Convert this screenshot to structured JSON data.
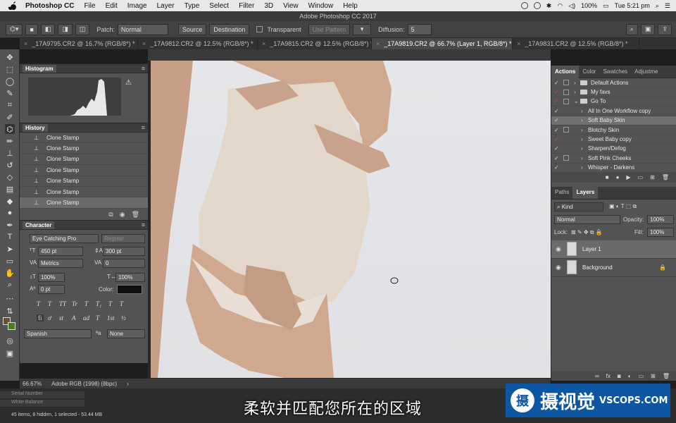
{
  "menubar": {
    "items": [
      "Photoshop CC",
      "File",
      "Edit",
      "Image",
      "Layer",
      "Type",
      "Select",
      "Filter",
      "3D",
      "View",
      "Window",
      "Help"
    ],
    "battery": "100%",
    "clock": "Tue 5:21 pm"
  },
  "window": {
    "title": "Adobe Photoshop CC 2017"
  },
  "options": {
    "patch_label": "Patch:",
    "patch_mode": "Normal",
    "source": "Source",
    "destination": "Destination",
    "transparent": "Transparent",
    "use_pattern": "Use Pattern",
    "diffusion_label": "Diffusion:",
    "diffusion_value": "5"
  },
  "tabs": [
    "_17A9795.CR2 @ 16.7% (RGB/8*) *",
    "_17A9812.CR2 @ 12.5% (RGB/8*) *",
    "_17A9815.CR2 @ 12.5% (RGB/8*) *",
    "_17A9819.CR2 @ 66.7% (Layer 1, RGB/8*) *",
    "_17A9831.CR2 @ 12.5% (RGB/8*) *"
  ],
  "histogram": {
    "title": "Histogram"
  },
  "history": {
    "title": "History",
    "items": [
      "Clone Stamp",
      "Clone Stamp",
      "Clone Stamp",
      "Clone Stamp",
      "Clone Stamp",
      "Clone Stamp",
      "Clone Stamp"
    ]
  },
  "character": {
    "title": "Character",
    "font_family": "Eye Catching Pro",
    "font_style": "Regular",
    "size": "450 pt",
    "leading": "300 pt",
    "kerning": "Metrics",
    "tracking": "0",
    "vscale": "100%",
    "hscale": "100%",
    "baseline": "0 pt",
    "color_label": "Color:",
    "language": "Spanish",
    "aa_label": "a",
    "antialias": "None",
    "type_buttons": [
      "T",
      "T",
      "TT",
      "Tr",
      "T",
      "T₁",
      "T",
      "T"
    ],
    "ligature_buttons": [
      "fi",
      "ơ",
      "st",
      "A",
      "ad",
      "T",
      "1st",
      "½"
    ]
  },
  "actions": {
    "tabs": [
      "Actions",
      "Color",
      "Swatches",
      "Adjustme"
    ],
    "items": [
      {
        "label": "Default Actions",
        "type": "set",
        "open": false,
        "check_red": false
      },
      {
        "label": "My favs",
        "type": "set",
        "open": false,
        "check_red": true
      },
      {
        "label": "Go To",
        "type": "set",
        "open": true,
        "check_red": true
      },
      {
        "label": "All In One Workflow copy",
        "type": "action",
        "check_red": false
      },
      {
        "label": "Soft Baby Skin",
        "type": "action",
        "check_red": false,
        "highlight": true
      },
      {
        "label": "Blotchy Skin",
        "type": "action",
        "check_red": false
      },
      {
        "label": "Sweet Baby copy",
        "type": "action",
        "check_red": true
      },
      {
        "label": "Sharpen/Defog",
        "type": "action",
        "check_red": false
      },
      {
        "label": "Soft Pink Cheeks",
        "type": "action",
        "check_red": false
      },
      {
        "label": "Whisper - Darkens",
        "type": "action",
        "check_red": false
      }
    ]
  },
  "layers": {
    "tabs": [
      "Paths",
      "Layers"
    ],
    "kind": "Kind",
    "blend": "Normal",
    "opacity_label": "Opacity:",
    "opacity": "100%",
    "lock_label": "Lock:",
    "fill_label": "Fill:",
    "fill": "100%",
    "items": [
      {
        "name": "Layer 1",
        "selected": true,
        "locked": false
      },
      {
        "name": "Background",
        "selected": false,
        "locked": true
      }
    ]
  },
  "status": {
    "zoom": "66.67%",
    "profile": "Adobe RGB (1998) (8bpc)"
  },
  "bridge": {
    "rows": [
      "Serial Number",
      "White Balance"
    ],
    "info": "45 items, 8 hidden, 1 selected - 53.44 MB"
  },
  "subtitle": "柔软并匹配您所在的区域",
  "watermark": {
    "icon": "摄",
    "cn": "摄视觉",
    "en": "VSCOPS.COM"
  },
  "colors": {
    "panel": "#535353",
    "accent": "#0c56a4"
  }
}
